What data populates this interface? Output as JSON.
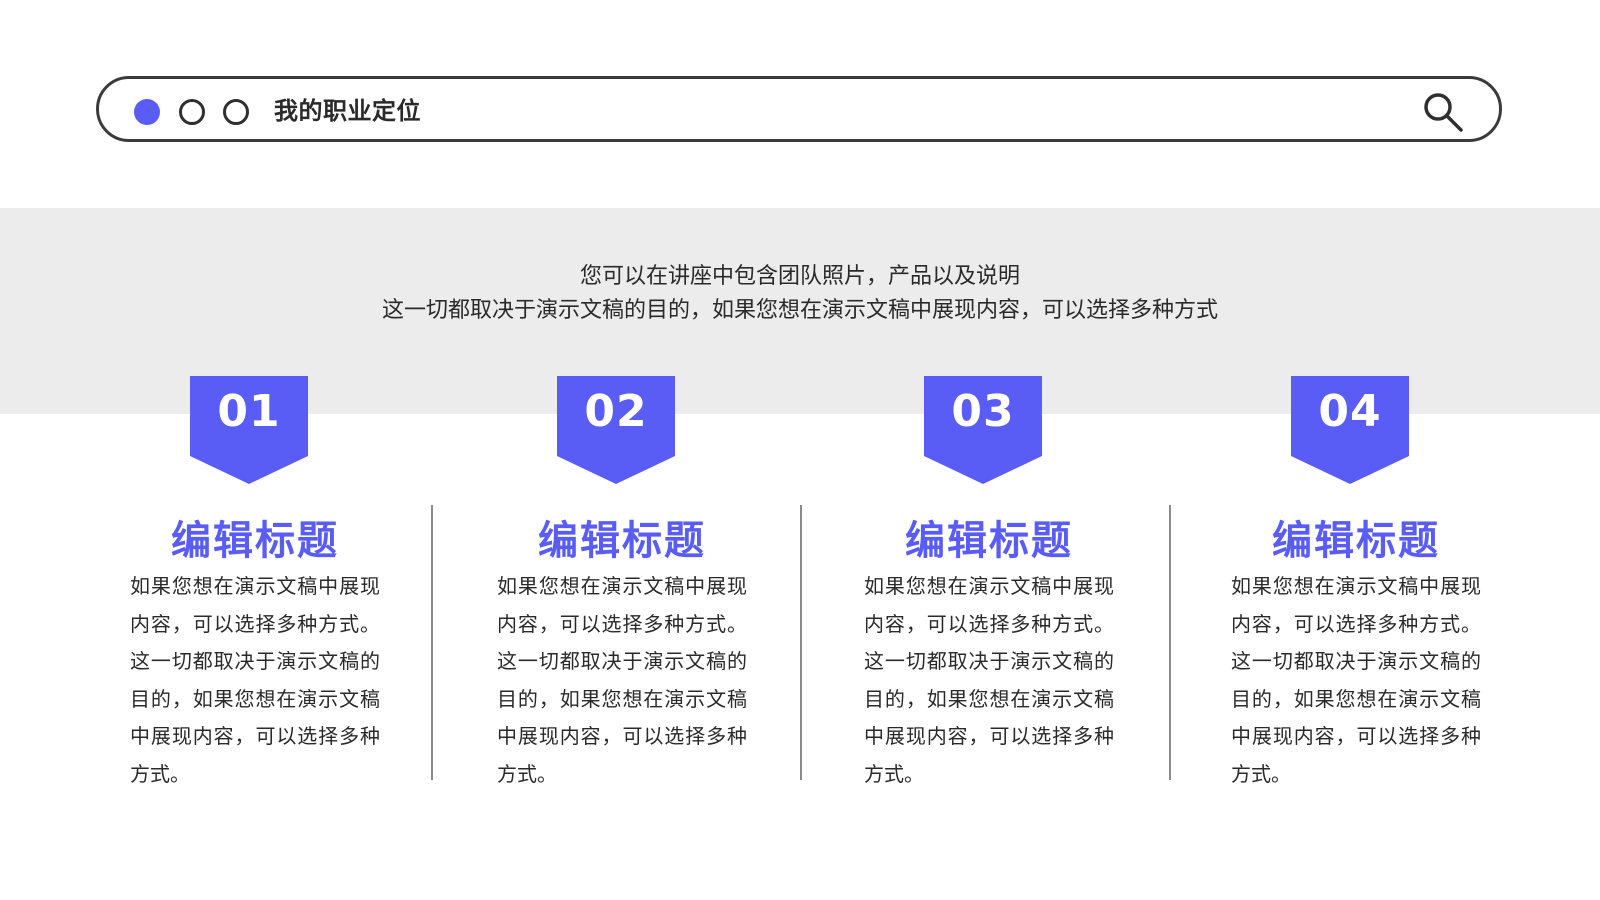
{
  "header": {
    "title": "我的职业定位",
    "dots": [
      "filled",
      "outline",
      "outline"
    ],
    "search_icon": "search-icon"
  },
  "intro": {
    "line1": "您可以在讲座中包含团队照片，产品以及说明",
    "line2": "这一切都取决于演示文稿的目的，如果您想在演示文稿中展现内容，可以选择多种方式"
  },
  "columns": [
    {
      "number": "01",
      "title": "编辑标题",
      "body": "如果您想在演示文稿中展现内容，可以选择多种方式。这一切都取决于演示文稿的目的，如果您想在演示文稿中展现内容，可以选择多种方式。"
    },
    {
      "number": "02",
      "title": "编辑标题",
      "body": "如果您想在演示文稿中展现内容，可以选择多种方式。这一切都取决于演示文稿的目的，如果您想在演示文稿中展现内容，可以选择多种方式。"
    },
    {
      "number": "03",
      "title": "编辑标题",
      "body": "如果您想在演示文稿中展现内容，可以选择多种方式。这一切都取决于演示文稿的目的，如果您想在演示文稿中展现内容，可以选择多种方式。"
    },
    {
      "number": "04",
      "title": "编辑标题",
      "body": "如果您想在演示文稿中展现内容，可以选择多种方式。这一切都取决于演示文稿的目的，如果您想在演示文稿中展现内容，可以选择多种方式。"
    }
  ],
  "colors": {
    "accent": "#5a5df5",
    "band": "#ececec",
    "text": "#2a2a2a"
  }
}
